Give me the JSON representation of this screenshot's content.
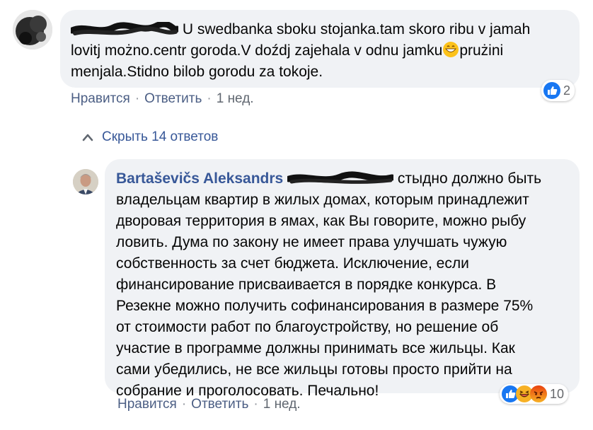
{
  "comment1": {
    "text_line1": "U swedbanka sboku stojanka.tam skoro ribu v jamah",
    "text_line2a": "lovitj możno.centr goroda.V doźdj zajehala v odnu jamku",
    "text_line2b": "prużini",
    "text_line3": "menjala.Stidno bilob gorodu za tokoje.",
    "actions": {
      "like": "Нравится",
      "reply": "Ответить",
      "time": "1 нед."
    },
    "reaction_count": "2"
  },
  "toggle_replies": {
    "label": "Скрыть 14 ответов"
  },
  "comment2": {
    "author": "Bartaševičs Aleksandrs",
    "lines": [
      "стыдно должно быть",
      "владельцам квартир в жилых домах, которым принадлежит",
      "дворовая территория в ямах, как Вы говорите, можно рыбу",
      "ловить. Дума по закону не имеет права улучшать чужую",
      "собственность за счет бюджета. Исключение, если",
      "финансирование присваивается в порядке конкурса. В",
      "Резекне можно получить софинансирования в размере 75%",
      "от стоимости работ по благоустройству, но решение об",
      "участие в программе должны принимать все жильцы. Как",
      "сами убедились, не все жильцы готовы просто прийти на",
      "собрание и проголосовать. Печально!"
    ],
    "actions": {
      "like": "Нравится",
      "reply": "Ответить",
      "time": "1 нед."
    },
    "reaction_count": "10"
  },
  "icons": {
    "like": "like-reaction-icon",
    "haha": "haha-reaction-icon",
    "angry": "angry-reaction-icon",
    "chevron": "chevron-up-icon",
    "emoji": "grinning-emoji-icon"
  },
  "colors": {
    "link": "#385898",
    "bubble": "#f0f2f5",
    "like_blue": "#1877f2",
    "haha_yellow": "#f7b125",
    "angry_orange": "#e9710f"
  }
}
